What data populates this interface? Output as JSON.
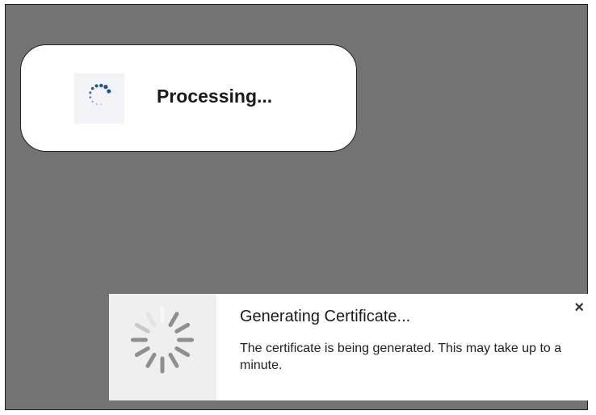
{
  "processing_dialog": {
    "text": "Processing...",
    "spinner_icon": "loading-dots-icon",
    "spinner_color": "#1f4e9c"
  },
  "toast": {
    "icon": "loading-spinner-icon",
    "title": "Generating Certificate...",
    "message": "The certificate is being generated.  This may take up to a minute.",
    "close_glyph": "×"
  },
  "colors": {
    "backdrop": "#737373",
    "dialog_bg": "#ffffff",
    "spinner_gray": "#9a9a9a"
  }
}
